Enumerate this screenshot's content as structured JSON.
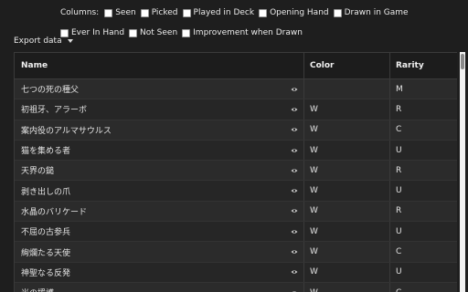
{
  "filters": {
    "label": "Columns:",
    "row1": [
      {
        "label": "Seen",
        "checked": false
      },
      {
        "label": "Picked",
        "checked": false
      },
      {
        "label": "Played in Deck",
        "checked": false
      },
      {
        "label": "Opening Hand",
        "checked": false
      },
      {
        "label": "Drawn in Game",
        "checked": false
      }
    ],
    "row2": [
      {
        "label": "Ever In Hand",
        "checked": false
      },
      {
        "label": "Not Seen",
        "checked": false
      },
      {
        "label": "Improvement when Drawn",
        "checked": false
      }
    ]
  },
  "export": {
    "label": "Export data"
  },
  "table": {
    "headers": {
      "name": "Name",
      "color": "Color",
      "rarity": "Rarity"
    },
    "rows": [
      {
        "name": "七つの死の種父",
        "color": "",
        "rarity": "M"
      },
      {
        "name": "初祖牙、アラーボ",
        "color": "W",
        "rarity": "R"
      },
      {
        "name": "案内役のアルマサウルス",
        "color": "W",
        "rarity": "C"
      },
      {
        "name": "猫を集める者",
        "color": "W",
        "rarity": "U"
      },
      {
        "name": "天界の鎚",
        "color": "W",
        "rarity": "R"
      },
      {
        "name": "剥き出しの爪",
        "color": "W",
        "rarity": "U"
      },
      {
        "name": "水晶のバリケード",
        "color": "W",
        "rarity": "R"
      },
      {
        "name": "不屈の古参兵",
        "color": "W",
        "rarity": "U"
      },
      {
        "name": "絢爛たる天使",
        "color": "W",
        "rarity": "C"
      },
      {
        "name": "神聖なる反発",
        "color": "W",
        "rarity": "U"
      },
      {
        "name": "光の援護",
        "color": "W",
        "rarity": "C"
      }
    ]
  },
  "icons": {
    "preview": "eye-icon",
    "export": "chevron-down-icon"
  }
}
